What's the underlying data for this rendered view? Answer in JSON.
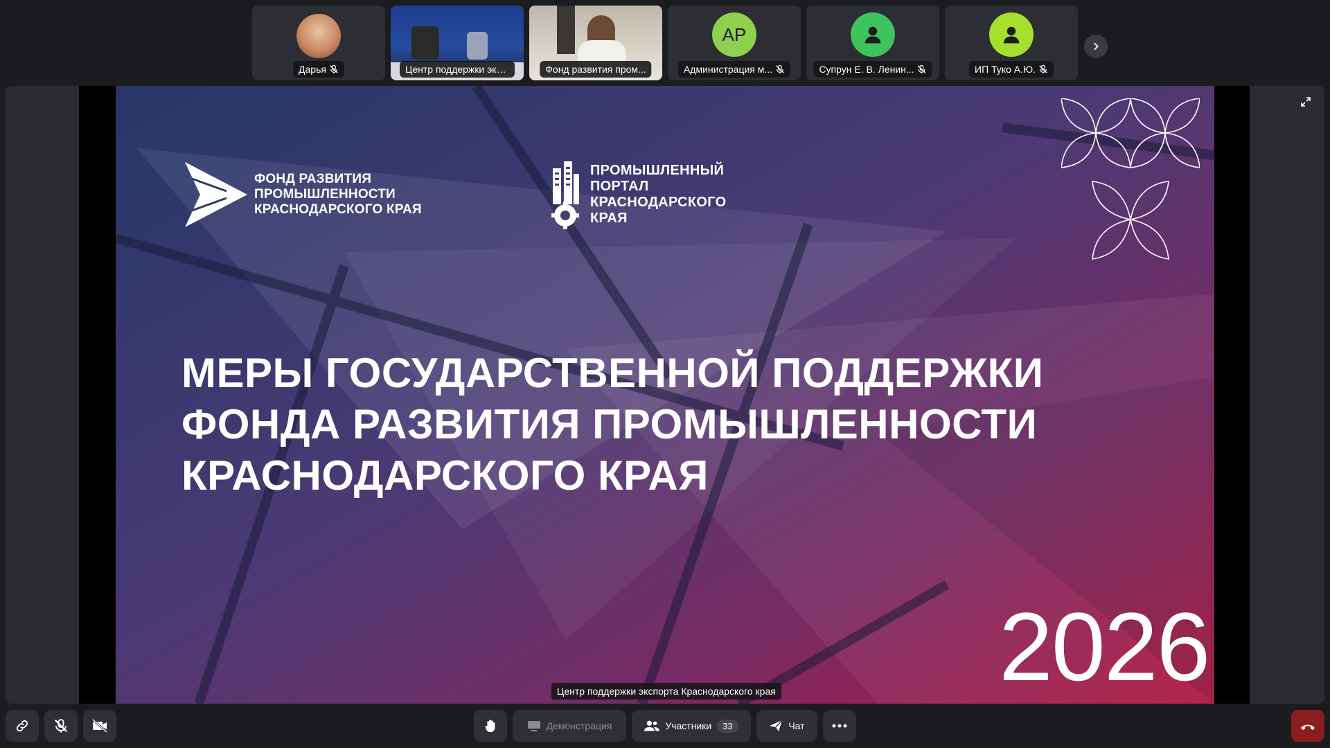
{
  "participants": [
    {
      "name": "Дарья",
      "type": "photo",
      "muted": true
    },
    {
      "name": "Центр поддержки экс...",
      "type": "video",
      "muted": false
    },
    {
      "name": "Фонд развития пром...",
      "type": "video",
      "muted": false,
      "active": true
    },
    {
      "name": "Администрация м...",
      "type": "initials",
      "initials": "АР",
      "color": "#8fd14f",
      "muted": true
    },
    {
      "name": "Супрун Е. В. Ленин...",
      "type": "icon",
      "color": "#3ec45e",
      "muted": true
    },
    {
      "name": "ИП Туко А.Ю.",
      "type": "icon",
      "color": "#a7e02c",
      "muted": true
    }
  ],
  "slide": {
    "logo_left": [
      "ФОНД РАЗВИТИЯ",
      "ПРОМЫШЛЕННОСТИ",
      "КРАСНОДАРСКОГО КРАЯ"
    ],
    "logo_right": [
      "ПРОМЫШЛЕННЫЙ",
      "ПОРТАЛ",
      "КРАСНОДАРСКОГО",
      "КРАЯ"
    ],
    "title": [
      "МЕРЫ ГОСУДАРСТВЕННОЙ ПОДДЕРЖКИ",
      "ФОНДА РАЗВИТИЯ ПРОМЫШЛЕННОСТИ",
      "КРАСНОДАРСКОГО КРАЯ"
    ],
    "year": "2026"
  },
  "speaker_label": "Центр поддержки экспорта Краснодарского края",
  "toolbar": {
    "screen_share_label": "Демонстрация",
    "participants_label": "Участники",
    "participants_count": "33",
    "chat_label": "Чат"
  },
  "colors": {
    "active_outline": "#3fd97a",
    "end_call": "#8a1d1d",
    "slide_gradient_start": "#2b3a68",
    "slide_gradient_end": "#b0173f"
  }
}
